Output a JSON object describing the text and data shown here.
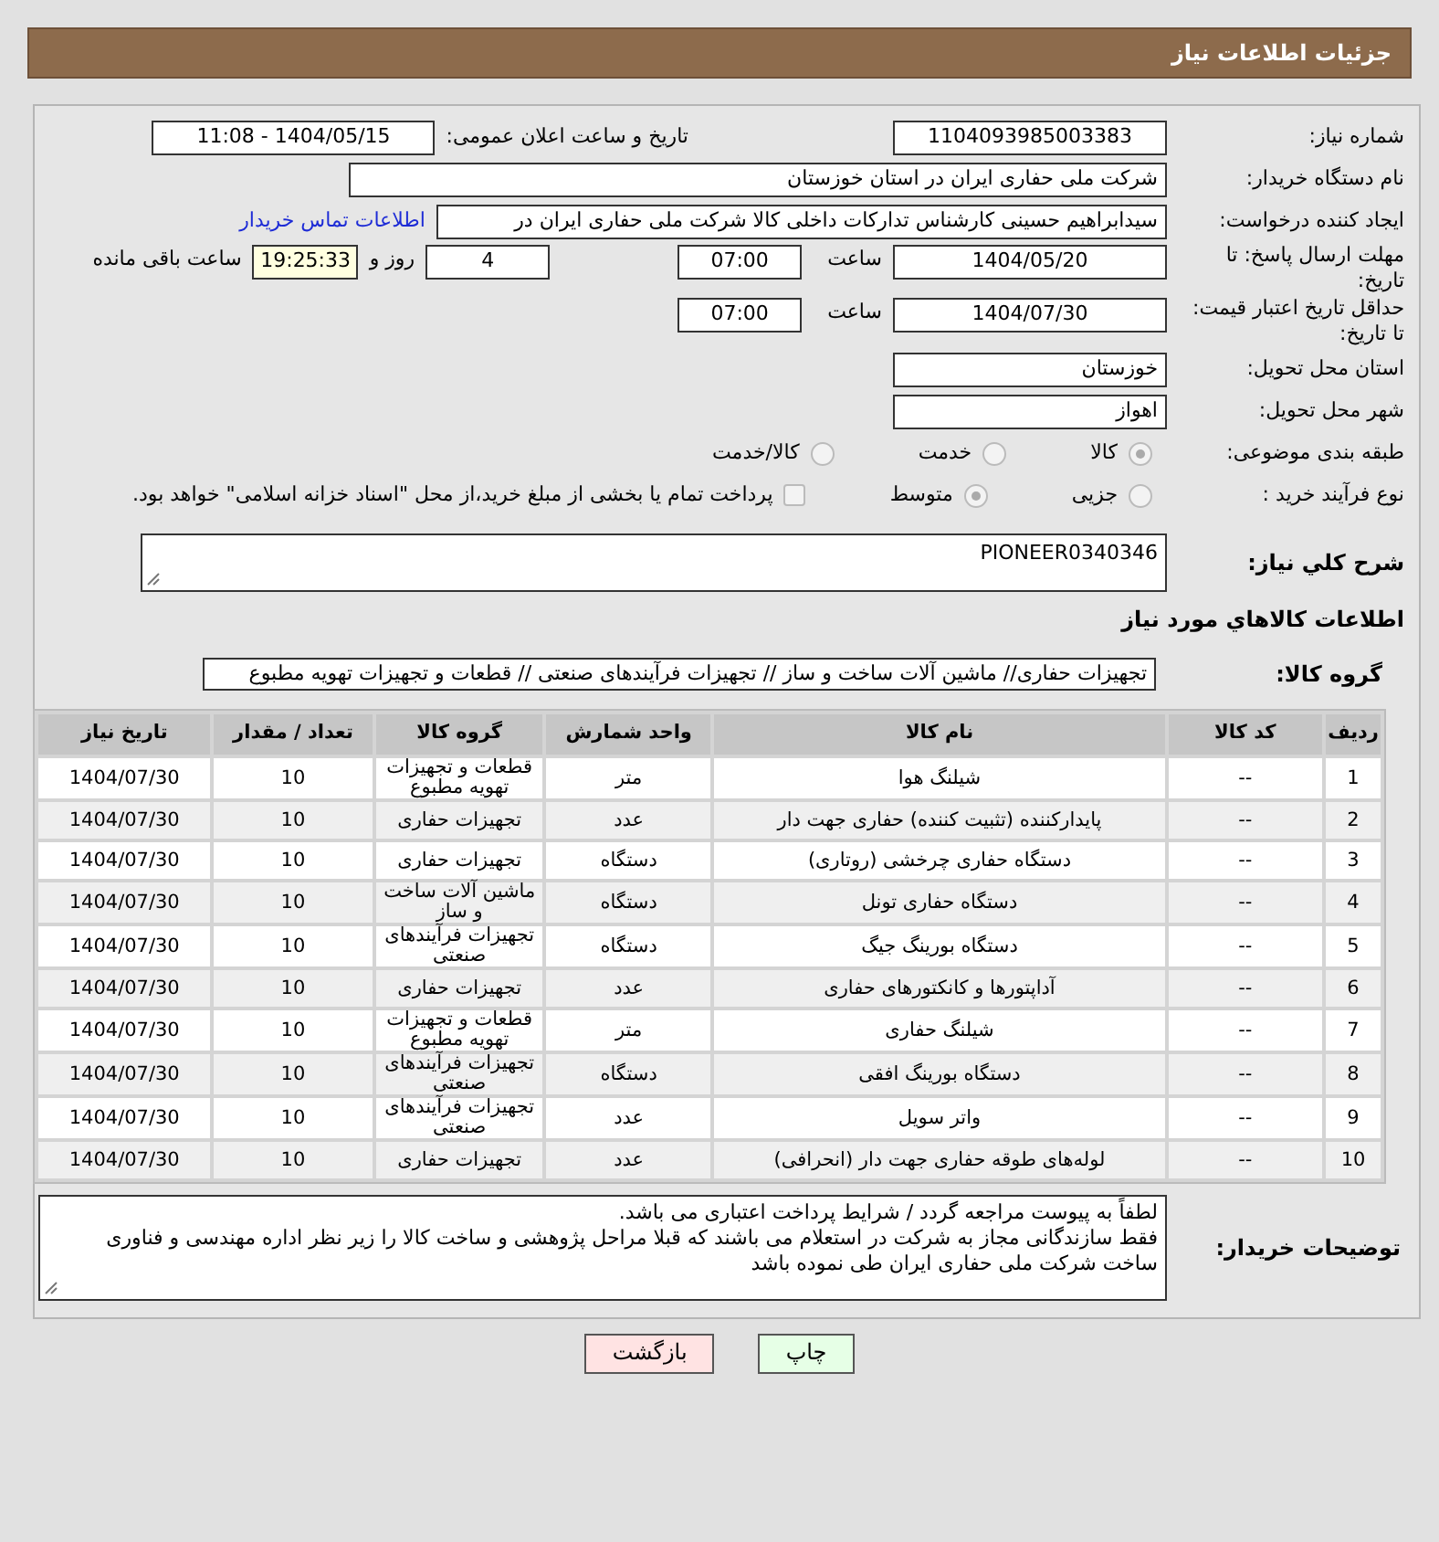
{
  "header": {
    "title": "جزئیات اطلاعات نیاز"
  },
  "need_number": {
    "label": "شماره نیاز:",
    "value": "1104093985003383"
  },
  "announce": {
    "label": "تاریخ و ساعت اعلان عمومی:",
    "value": "1404/05/15 - 11:08"
  },
  "buyer_org": {
    "label": "نام دستگاه خریدار:",
    "value": "شرکت ملی حفاری ایران در استان خوزستان"
  },
  "requester": {
    "label": "ایجاد کننده درخواست:",
    "value": "سیدابراهیم حسینی کارشناس تدارکات داخلی  کالا شرکت ملی حفاری ایران در",
    "link": "اطلاعات تماس خریدار"
  },
  "deadline": {
    "label": "مهلت ارسال پاسخ: تا تاریخ:",
    "date": "1404/05/20",
    "time_label": "ساعت",
    "time": "07:00",
    "days": "4",
    "days_label": "روز و",
    "remaining": "19:25:33",
    "remaining_label": "ساعت باقی مانده"
  },
  "validity": {
    "label": "حداقل تاریخ اعتبار قیمت: تا تاریخ:",
    "date": "1404/07/30",
    "time_label": "ساعت",
    "time": "07:00"
  },
  "province": {
    "label": "استان محل تحویل:",
    "value": "خوزستان"
  },
  "city": {
    "label": "شهر محل تحویل:",
    "value": "اهواز"
  },
  "category": {
    "label": "طبقه بندی موضوعی:",
    "options": [
      {
        "label": "کالا",
        "selected": true
      },
      {
        "label": "خدمت",
        "selected": false
      },
      {
        "label": "کالا/خدمت",
        "selected": false
      }
    ]
  },
  "process": {
    "label": "نوع فرآیند خرید :",
    "options": [
      {
        "label": "جزیی",
        "selected": false
      },
      {
        "label": "متوسط",
        "selected": true
      }
    ],
    "checkbox": {
      "label": "پرداخت تمام یا بخشی از مبلغ خرید،از محل \"اسناد خزانه اسلامی\" خواهد بود.",
      "checked": false
    }
  },
  "description": {
    "label": "شرح كلي نياز:",
    "value": "PIONEER0340346"
  },
  "goods_title": "اطلاعات كالاهاي مورد نياز",
  "group": {
    "label": "گروه کالا:",
    "value": "تجهیزات حفاری// ماشین آلات ساخت و ساز // تجهیزات فرآیندهای صنعتی //  قطعات و تجهیزات تهویه مطبوع"
  },
  "table": {
    "columns": [
      "ردیف",
      "کد کالا",
      "نام کالا",
      "واحد شمارش",
      "گروه کالا",
      "تعداد / مقدار",
      "تاریخ نیاز"
    ],
    "rows": [
      [
        "1",
        "--",
        "شیلنگ هوا",
        "متر",
        "قطعات و تجهیزات تهویه مطبوع",
        "10",
        "1404/07/30"
      ],
      [
        "2",
        "--",
        "پایدارکننده (تثبیت کننده) حفاری جهت دار",
        "عدد",
        "تجهیزات حفاری",
        "10",
        "1404/07/30"
      ],
      [
        "3",
        "--",
        "دستگاه حفاری چرخشی (روتاری)",
        "دستگاه",
        "تجهیزات حفاری",
        "10",
        "1404/07/30"
      ],
      [
        "4",
        "--",
        "دستگاه حفاری تونل",
        "دستگاه",
        "ماشین آلات ساخت و ساز",
        "10",
        "1404/07/30"
      ],
      [
        "5",
        "--",
        "دستگاه بورینگ جیگ",
        "دستگاه",
        "تجهیزات فرآیندهای صنعتی",
        "10",
        "1404/07/30"
      ],
      [
        "6",
        "--",
        "آداپتورها و کانکتورهای حفاری",
        "عدد",
        "تجهیزات حفاری",
        "10",
        "1404/07/30"
      ],
      [
        "7",
        "--",
        "شیلنگ حفاری",
        "متر",
        "قطعات و تجهیزات تهویه مطبوع",
        "10",
        "1404/07/30"
      ],
      [
        "8",
        "--",
        "دستگاه بورینگ افقی",
        "دستگاه",
        "تجهیزات فرآیندهای صنعتی",
        "10",
        "1404/07/30"
      ],
      [
        "9",
        "--",
        "واتر سویل",
        "عدد",
        "تجهیزات فرآیندهای صنعتی",
        "10",
        "1404/07/30"
      ],
      [
        "10",
        "--",
        "لوله‌های طوقه حفاری جهت دار (انحرافی)",
        "عدد",
        "تجهیزات حفاری",
        "10",
        "1404/07/30"
      ]
    ]
  },
  "notes": {
    "label": "توضیحات خریدار:",
    "lines": [
      "لطفاً به پیوست مراجعه گردد / شرایط پرداخت اعتباری می باشد.",
      "فقط سازندگانی مجاز به شرکت در استعلام می باشند که قبلا مراحل پژوهشی و ساخت کالا را زیر نظر اداره مهندسی و فناوری ساخت شرکت ملی حفاری ایران طی نموده باشد"
    ]
  },
  "buttons": [
    {
      "label": "چاپ",
      "kind": "print"
    },
    {
      "label": "بازگشت",
      "kind": "back"
    }
  ]
}
